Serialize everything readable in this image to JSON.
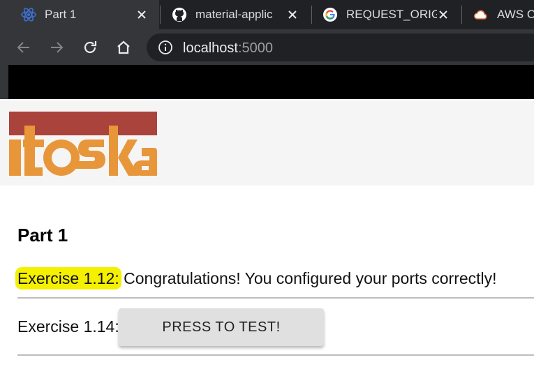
{
  "browser": {
    "tabs": [
      {
        "title": "Part 1",
        "favicon": "react-icon",
        "active": true
      },
      {
        "title": "material-applic",
        "favicon": "github-icon",
        "active": false
      },
      {
        "title": "REQUEST_ORIG",
        "favicon": "google-icon",
        "active": false
      },
      {
        "title": "AWS C",
        "favicon": "cloud-icon",
        "active": false
      }
    ],
    "url_host": "localhost",
    "url_port": ":5000"
  },
  "page": {
    "logo_text": "itoska",
    "title": "Part 1",
    "exercise_1_12": {
      "label": "Exercise 1.12:",
      "message": " Congratulations! You configured your ports correctly!"
    },
    "exercise_1_14": {
      "label": "Exercise 1.14:",
      "button_label": "PRESS TO TEST!"
    }
  },
  "colors": {
    "highlight": "#f4f000",
    "logo_red": "#a9433c",
    "logo_orange": "#e8963a"
  }
}
